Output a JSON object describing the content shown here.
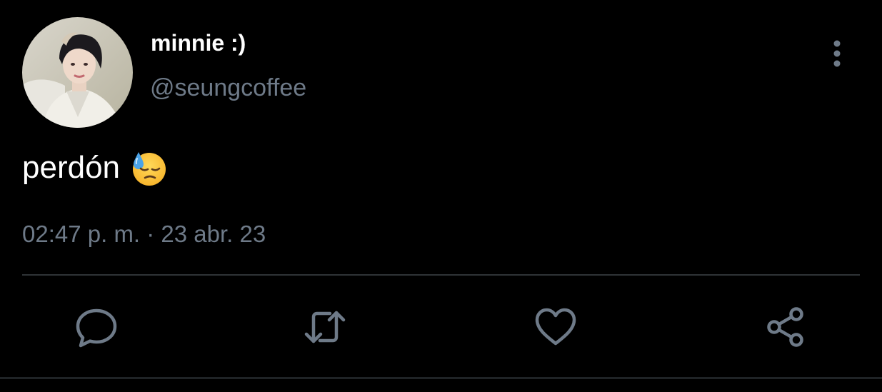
{
  "tweet": {
    "display_name": "minnie :)",
    "handle": "@seungcoffee",
    "text": "perdón",
    "emoji": "downcast-face-with-sweat",
    "timestamp": "02:47 p. m. · 23 abr. 23"
  },
  "icons": {
    "more": "more-vertical-icon",
    "reply": "reply-icon",
    "retweet": "retweet-icon",
    "like": "heart-icon",
    "share": "share-icon"
  },
  "colors": {
    "background": "#000000",
    "primary_text": "#ffffff",
    "secondary_text": "#6e7a88",
    "icon": "#6e7a88",
    "divider": "#2f3336"
  }
}
